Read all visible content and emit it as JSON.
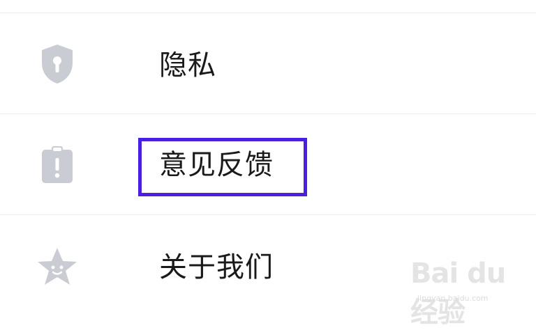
{
  "menu": {
    "items": [
      {
        "label": "隐私",
        "icon": "shield-keyhole-icon"
      },
      {
        "label": "意见反馈",
        "icon": "feedback-clipboard-icon"
      },
      {
        "label": "关于我们",
        "icon": "star-face-icon"
      }
    ]
  },
  "colors": {
    "icon": "#c9ccd3",
    "highlight": "#4a1fe0",
    "divider": "#eeeeee"
  },
  "watermark": {
    "logo": "Bai du 经验",
    "site": "jingyan.baidu.com"
  }
}
